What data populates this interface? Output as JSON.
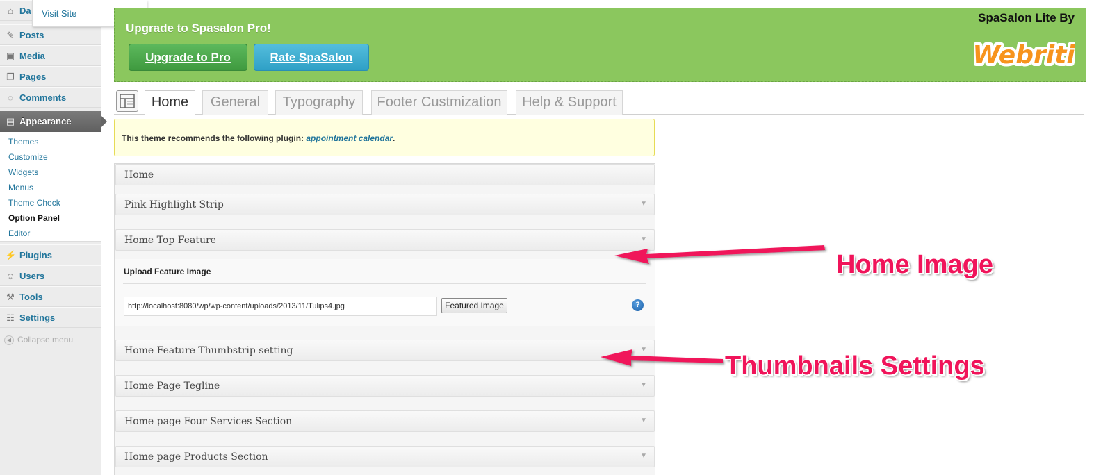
{
  "sidebar": {
    "menu": [
      {
        "label": "Da",
        "icon": "home-icon"
      },
      {
        "label": "Posts",
        "icon": "pin-icon"
      },
      {
        "label": "Media",
        "icon": "media-icon"
      },
      {
        "label": "Pages",
        "icon": "pages-icon"
      },
      {
        "label": "Comments",
        "icon": "comment-icon"
      },
      {
        "label": "Appearance",
        "icon": "appearance-icon"
      },
      {
        "label": "Plugins",
        "icon": "plugin-icon"
      },
      {
        "label": "Users",
        "icon": "users-icon"
      },
      {
        "label": "Tools",
        "icon": "tools-icon"
      },
      {
        "label": "Settings",
        "icon": "settings-icon"
      }
    ],
    "submenu": [
      "Themes",
      "Customize",
      "Widgets",
      "Menus",
      "Theme Check",
      "Option Panel",
      "Editor"
    ],
    "collapse_label": "Collapse menu"
  },
  "flyout": {
    "visit_site": "Visit Site"
  },
  "banner": {
    "title": "Upgrade to Spasalon Pro!",
    "upgrade_button": "Upgrade to Pro",
    "rate_button": "Rate SpaSalon",
    "brand_by": "SpaSalon Lite By",
    "brand_logo": "Webriti",
    "background_color": "#8bc75e"
  },
  "tabs": [
    "Home",
    "General",
    "Typography",
    "Footer Custmization",
    "Help & Support"
  ],
  "notice": {
    "text": "This theme recommends the following plugin: ",
    "link": "appointment calendar",
    "end": "."
  },
  "sections": {
    "header": "Home",
    "items": [
      "Pink Highlight Strip",
      "Home Top Feature",
      "Home Feature Thumbstrip setting",
      "Home Page Tegline",
      "Home page Four Services Section",
      "Home page Products Section"
    ]
  },
  "feature": {
    "upload_label": "Upload Feature Image",
    "image_url": "http://localhost:8080/wp/wp-content/uploads/2013/11/Tulips4.jpg",
    "button_label": "Featured Image",
    "help_glyph": "?"
  },
  "annotations": {
    "home_image": "Home Image",
    "thumbnails": "Thumbnails Settings",
    "color": "#f0145a"
  }
}
